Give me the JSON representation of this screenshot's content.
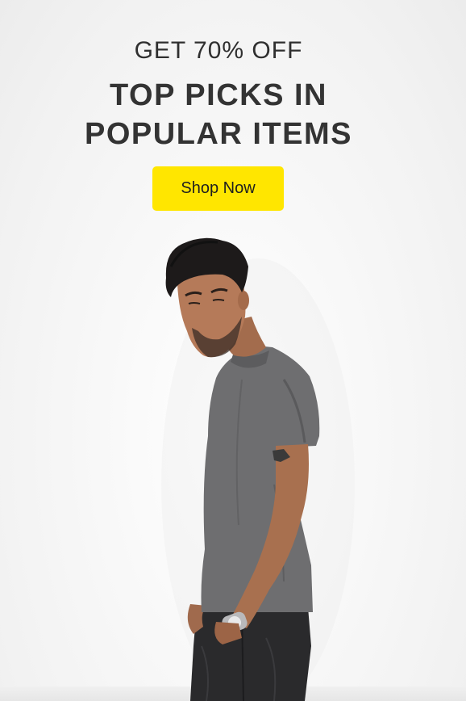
{
  "promo": {
    "subtitle": "GET 70% OFF",
    "headline_line1": "TOP PICKS IN",
    "headline_line2": "POPULAR ITEMS",
    "cta_label": "Shop Now",
    "cta_color": "#ffe600"
  },
  "colors": {
    "background": "#f4f4f4",
    "text": "#333333",
    "tshirt": "#6e6e70",
    "jeans": "#2a2a2c"
  },
  "image": {
    "subject": "model-photo"
  }
}
